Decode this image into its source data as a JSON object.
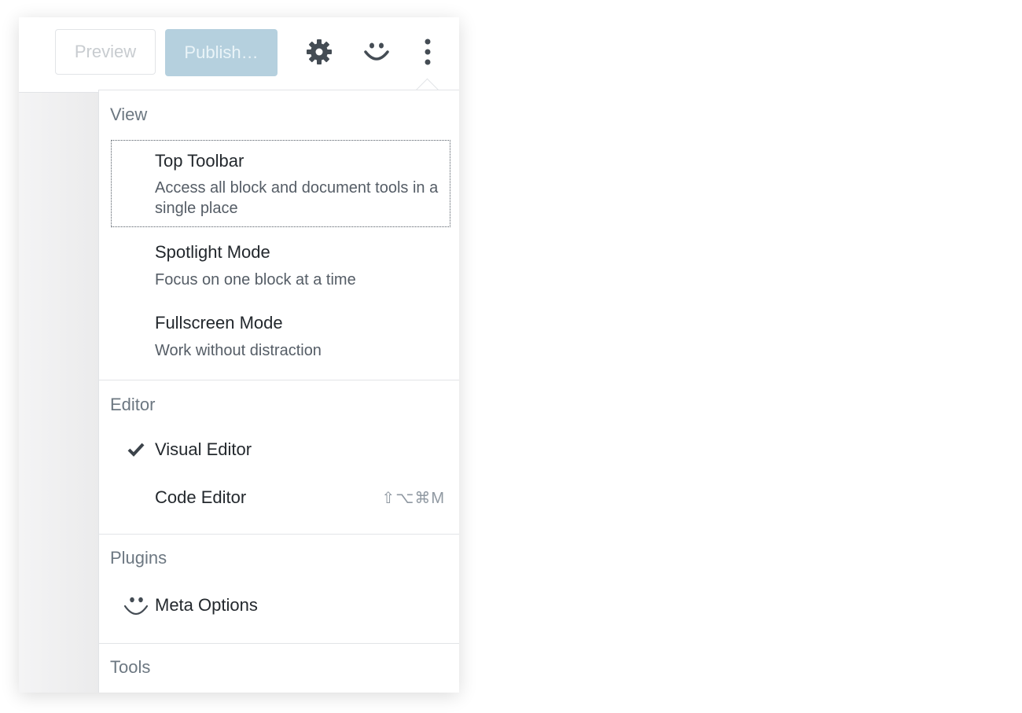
{
  "toolbar": {
    "preview_label": "Preview",
    "publish_label": "Publish…",
    "settings_icon": "gear-icon",
    "plugin_icon": "smiley-icon",
    "more_icon": "vertical-ellipsis-icon"
  },
  "menu": {
    "view": {
      "title": "View",
      "items": [
        {
          "label": "Top Toolbar",
          "description": "Access all block and document tools in a single place",
          "focused": true
        },
        {
          "label": "Spotlight Mode",
          "description": "Focus on one block at a time"
        },
        {
          "label": "Fullscreen Mode",
          "description": "Work without distraction"
        }
      ]
    },
    "editor": {
      "title": "Editor",
      "items": [
        {
          "label": "Visual Editor",
          "checked": true,
          "icon": "checkmark-icon"
        },
        {
          "label": "Code Editor",
          "shortcut": "⇧⌥⌘M"
        }
      ]
    },
    "plugins": {
      "title": "Plugins",
      "items": [
        {
          "label": "Meta Options",
          "icon": "smiley-icon"
        }
      ]
    },
    "tools": {
      "title": "Tools"
    }
  },
  "colors": {
    "publish_bg": "#b5d0de",
    "text_dark": "#23282d",
    "section_title": "#6c7781",
    "border": "#e2e4e7"
  }
}
